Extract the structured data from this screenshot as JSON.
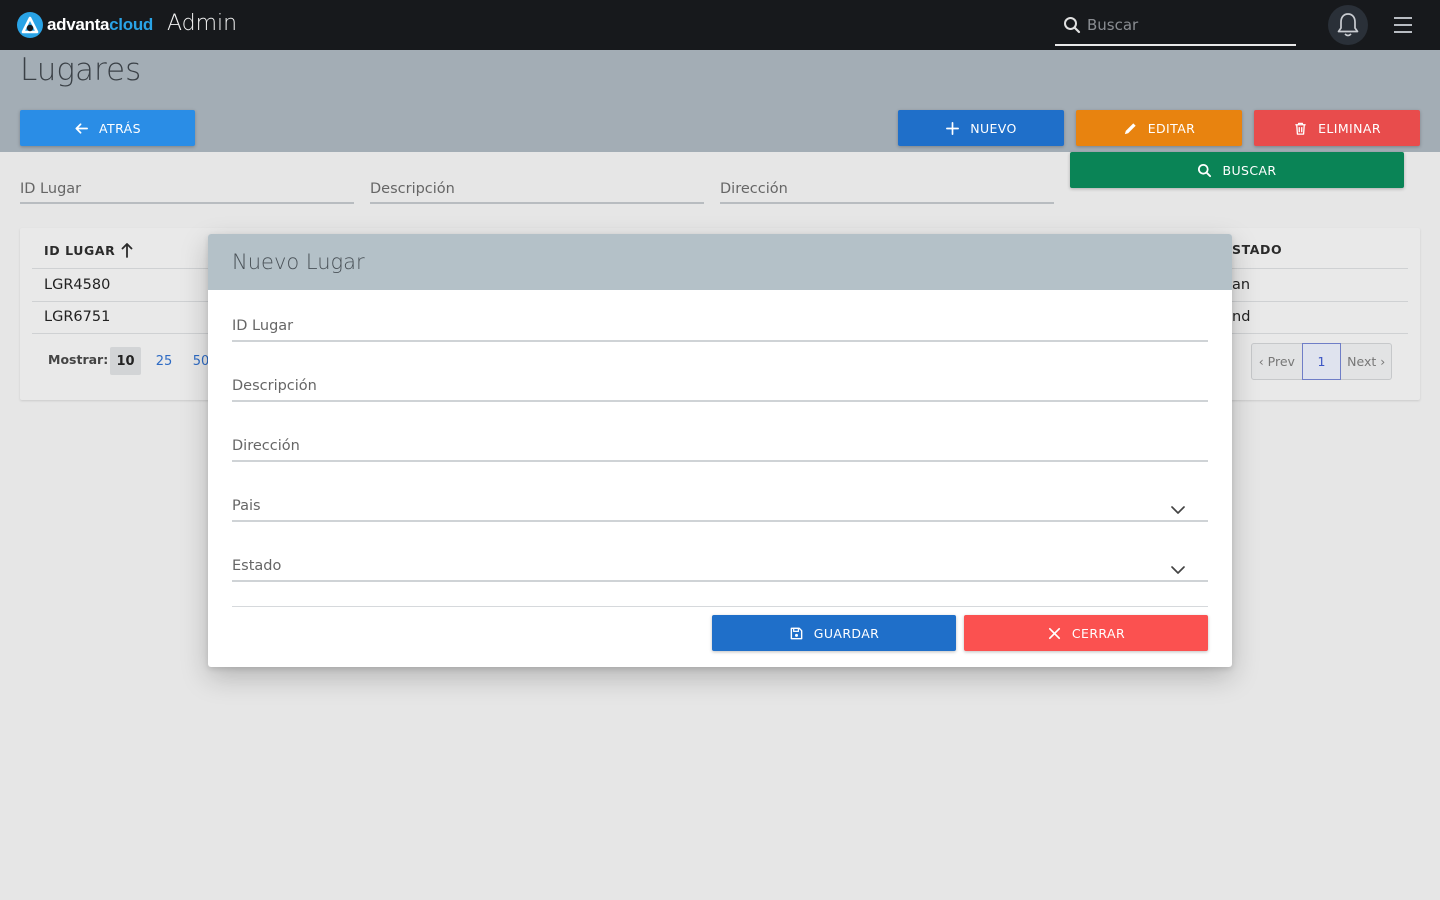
{
  "topbar": {
    "logo_text_a": "advanta",
    "logo_text_b": "cloud",
    "app_title": "Admin",
    "search_placeholder": "Buscar"
  },
  "page": {
    "title": "Lugares",
    "back_label": "ATRÁS",
    "new_label": "NUEVO",
    "edit_label": "EDITAR",
    "delete_label": "ELIMINAR",
    "search_label": "BUSCAR"
  },
  "filters": {
    "id_placeholder": "ID Lugar",
    "desc_placeholder": "Descripción",
    "dir_placeholder": "Dirección"
  },
  "table": {
    "headers": {
      "id": "ID LUGAR",
      "estado": "STADO"
    },
    "rows": [
      {
        "id": "LGR4580",
        "estado": "an"
      },
      {
        "id": "LGR6751",
        "estado": "nd"
      }
    ],
    "mostrar_label": "Mostrar:",
    "page_sizes": [
      "10",
      "25",
      "50"
    ],
    "pager": {
      "prev": "‹ Prev",
      "current": "1",
      "next": "Next ›"
    }
  },
  "modal": {
    "title": "Nuevo Lugar",
    "fields": {
      "id": "ID Lugar",
      "desc": "Descripción",
      "dir": "Dirección",
      "pais": "Pais",
      "estado": "Estado"
    },
    "save_label": "GUARDAR",
    "close_label": "CERRAR"
  },
  "colors": {
    "topbar": "#17191c",
    "header_band": "#a3adb5",
    "back": "#2a8de6",
    "new": "#1f6fc9",
    "edit": "#e8830f",
    "delete": "#e84c4c",
    "search": "#0a8456",
    "close": "#fb5150"
  }
}
